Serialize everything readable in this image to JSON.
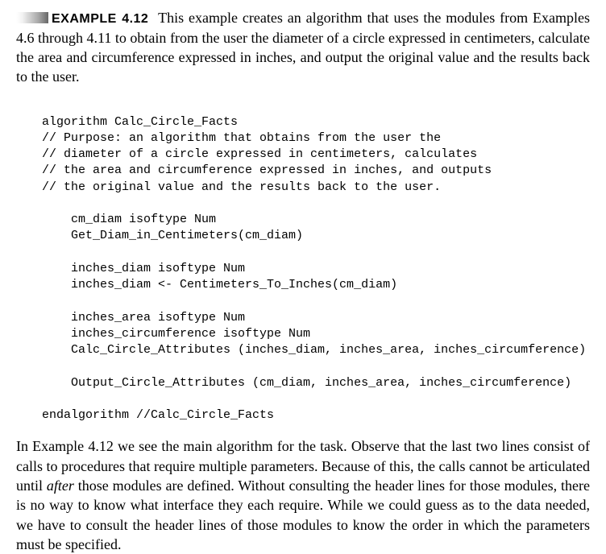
{
  "example": {
    "label": "EXAMPLE 4.12",
    "intro_rest": "This example creates an algorithm that uses the modules from Examples 4.6 through 4.11 to obtain from the user the diameter of a circle expressed in centimeters, calculate the area and circumference expressed in inches, and output the original value and the results back to the user."
  },
  "code": {
    "l01": "algorithm Calc_Circle_Facts",
    "l02": "// Purpose: an algorithm that obtains from the user the",
    "l03": "// diameter of a circle expressed in centimeters, calculates",
    "l04": "// the area and circumference expressed in inches, and outputs",
    "l05": "// the original value and the results back to the user.",
    "l06": "    cm_diam isoftype Num",
    "l07": "    Get_Diam_in_Centimeters(cm_diam)",
    "l08": "    inches_diam isoftype Num",
    "l09": "    inches_diam <- Centimeters_To_Inches(cm_diam)",
    "l10": "    inches_area isoftype Num",
    "l11": "    inches_circumference isoftype Num",
    "l12": "    Calc_Circle_Attributes (inches_diam, inches_area, inches_circumference)",
    "l13": "    Output_Circle_Attributes (cm_diam, inches_area, inches_circumference)",
    "l14": "endalgorithm //Calc_Circle_Facts"
  },
  "outro": {
    "part1": "In Example 4.12 we see the main algorithm for the task. Observe that the last two lines consist of calls to procedures that require multiple parameters. Because of this, the calls cannot be articulated until ",
    "after": "after",
    "part2": " those modules are defined. Without consulting the header lines for those modules, there is no way to know what interface they each require. While we could guess as to the data needed, we have to consult the header lines of those modules to know the order in which the parameters must be specified."
  }
}
